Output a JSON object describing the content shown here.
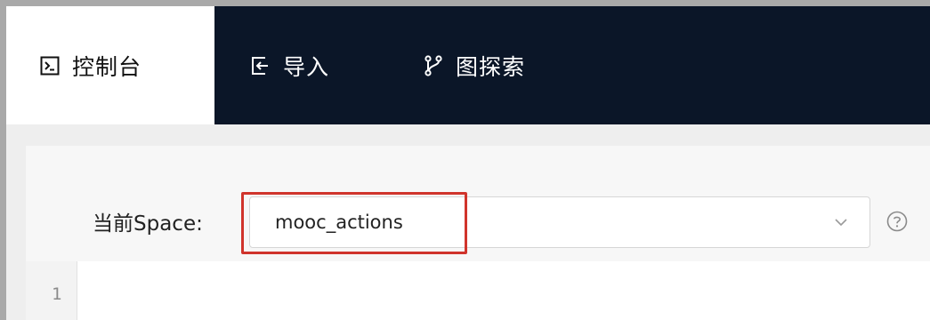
{
  "nav": {
    "tabs": [
      {
        "label": "控制台",
        "icon": "terminal-icon",
        "active": true
      },
      {
        "label": "导入",
        "icon": "import-icon",
        "active": false
      },
      {
        "label": "图探索",
        "icon": "branch-icon",
        "active": false
      }
    ]
  },
  "space": {
    "label": "当前Space:",
    "selected": "mooc_actions",
    "highlight_color": "#d0342c"
  },
  "help": {
    "icon": "question-circle-icon"
  },
  "editor": {
    "line_numbers": [
      "1"
    ]
  },
  "colors": {
    "nav_background": "#0b1628",
    "active_tab_background": "#ffffff",
    "content_background": "#eeeeee"
  }
}
